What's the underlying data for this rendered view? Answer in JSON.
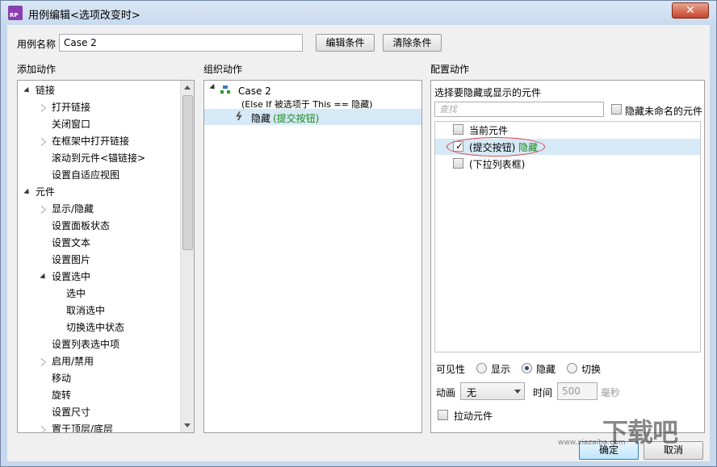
{
  "window": {
    "title": "用例编辑<选项改变时>",
    "app_icon_text": "RP",
    "close_glyph": "✕"
  },
  "top": {
    "case_name_label": "用例名称",
    "case_name_value": "Case 2",
    "edit_condition_button": "编辑条件",
    "clear_condition_button": "清除条件"
  },
  "add_actions": {
    "header": "添加动作",
    "items": [
      {
        "label": "链接",
        "level": 0,
        "expand": "open"
      },
      {
        "label": "打开链接",
        "level": 1,
        "expand": "closed"
      },
      {
        "label": "关闭窗口",
        "level": 1,
        "expand": "none"
      },
      {
        "label": "在框架中打开链接",
        "level": 1,
        "expand": "closed"
      },
      {
        "label": "滚动到元件<锚链接>",
        "level": 1,
        "expand": "none"
      },
      {
        "label": "设置自适应视图",
        "level": 1,
        "expand": "none"
      },
      {
        "label": "元件",
        "level": 0,
        "expand": "open"
      },
      {
        "label": "显示/隐藏",
        "level": 1,
        "expand": "closed"
      },
      {
        "label": "设置面板状态",
        "level": 1,
        "expand": "none"
      },
      {
        "label": "设置文本",
        "level": 1,
        "expand": "none"
      },
      {
        "label": "设置图片",
        "level": 1,
        "expand": "none"
      },
      {
        "label": "设置选中",
        "level": 1,
        "expand": "open"
      },
      {
        "label": "选中",
        "level": 2,
        "expand": "none"
      },
      {
        "label": "取消选中",
        "level": 2,
        "expand": "none"
      },
      {
        "label": "切换选中状态",
        "level": 2,
        "expand": "none"
      },
      {
        "label": "设置列表选中项",
        "level": 1,
        "expand": "none"
      },
      {
        "label": "启用/禁用",
        "level": 1,
        "expand": "closed"
      },
      {
        "label": "移动",
        "level": 1,
        "expand": "none"
      },
      {
        "label": "旋转",
        "level": 1,
        "expand": "none"
      },
      {
        "label": "设置尺寸",
        "level": 1,
        "expand": "none"
      },
      {
        "label": "置于顶层/底层",
        "level": 1,
        "expand": "closed"
      }
    ]
  },
  "organize": {
    "header": "组织动作",
    "case_title": "Case 2",
    "case_condition": "(Else If 被选项于 This == 隐藏)",
    "action_label": "隐藏",
    "action_target": "(提交按钮)"
  },
  "configure": {
    "header": "配置动作",
    "subheader": "选择要隐藏或显示的元件",
    "search_placeholder": "查找",
    "hide_unnamed_label": "隐藏未命名的元件",
    "widgets": [
      {
        "label": "当前元件",
        "checked": false,
        "state": ""
      },
      {
        "label": "(提交按钮)",
        "checked": true,
        "state": "隐藏"
      },
      {
        "label": "(下拉列表框)",
        "checked": false,
        "state": ""
      }
    ],
    "visibility_label": "可见性",
    "visibility_options": [
      "显示",
      "隐藏",
      "切换"
    ],
    "visibility_selected": "隐藏",
    "animation_label": "动画",
    "animation_value": "无",
    "time_label": "时间",
    "time_value": "500",
    "time_unit": "毫秒",
    "drag_widget_label": "拉动元件"
  },
  "footer": {
    "ok_button": "确定",
    "cancel_button": "取消"
  },
  "watermark": {
    "text": "下载吧",
    "url": "www.xiazaiba.com"
  }
}
